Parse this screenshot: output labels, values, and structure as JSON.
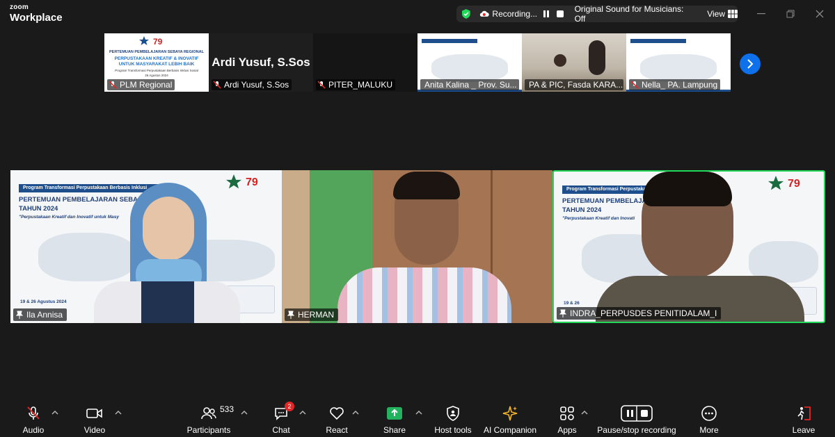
{
  "app": {
    "brand_top": "zoom",
    "brand_bottom": "Workplace"
  },
  "recording_bar": {
    "status": "Recording...",
    "sound": "Original Sound for Musicians: Off",
    "view": "View"
  },
  "top_strip": [
    {
      "name": "PLM Regional",
      "kind": "slide",
      "slide_lines": [
        "PERTEMUAN PEMBELAJARAN SEBAYA REGIONAL",
        "PERPUSTAKAAN KREATIF & INOVATIF",
        "UNTUK MASYARAKAT LEBIH BAIK",
        "Program Transformasi Perpustakaan Berbasis Inklusi Sosial",
        "26 Agustus 2024"
      ]
    },
    {
      "name": "Ardi Yusuf, S.Sos",
      "kind": "name",
      "display_name": "Ardi Yusuf, S.Sos"
    },
    {
      "name": "PITER_MALUKU",
      "kind": "dark"
    },
    {
      "name": "Anita Kalina _ Prov. Su...",
      "kind": "slide2"
    },
    {
      "name": "PA & PIC, Fasda KARA...",
      "kind": "video"
    },
    {
      "name": "Nella_ PA. Lampung",
      "kind": "slide2"
    }
  ],
  "gallery": [
    {
      "name": "Ila Annisa",
      "slide_band": "Program Transformasi Perpustakaan Berbasis Inklusi",
      "slide_title": [
        "PERTEMUAN PEMBELAJARAN SEBA",
        "TAHUN 2024"
      ],
      "slide_sub": "\"Perpustakaan Kreatif dan Inovatif untuk Masy",
      "slide_date": "19 & 26 Agustus 2024"
    },
    {
      "name": "HERMAN"
    },
    {
      "name": "INDRA_PERPUSDES PENITIDALAM_I",
      "slide_band": "Program Transformasi Perpustaka",
      "slide_title": [
        "PERTEMUAN PEMBELAJA",
        "TAHUN 2024"
      ],
      "slide_sub": "\"Perpustakaan Kreatif dan Inovati",
      "slide_date": "19 & 26"
    }
  ],
  "toolbar": {
    "audio": "Audio",
    "video": "Video",
    "participants": "Participants",
    "participants_count": "533",
    "chat": "Chat",
    "chat_badge": "2",
    "react": "React",
    "share": "Share",
    "host_tools": "Host tools",
    "ai_companion": "AI Companion",
    "apps": "Apps",
    "pause_stop": "Pause/stop recording",
    "more": "More",
    "leave": "Leave"
  },
  "colors": {
    "accent_blue": "#0e71eb",
    "active_speaker": "#23d959",
    "share_green": "#23b25d",
    "leave_red": "#e02828",
    "mute_red": "#e02828"
  }
}
